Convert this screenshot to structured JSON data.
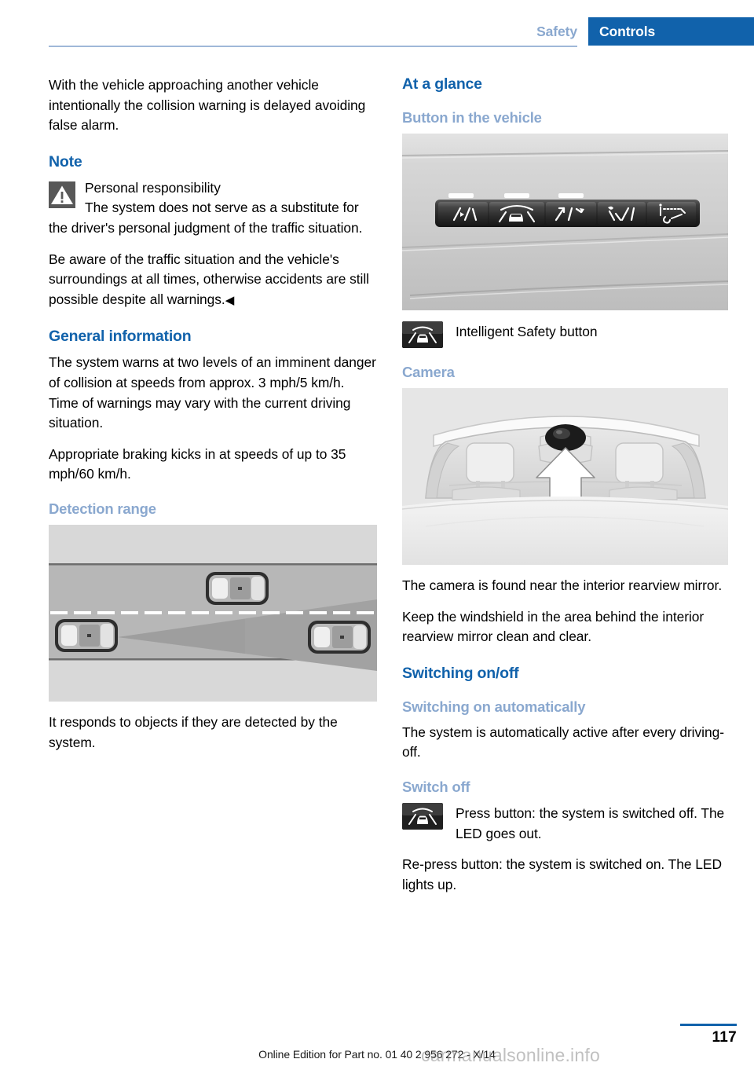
{
  "header": {
    "tab_inactive": "Safety",
    "tab_active": "Controls",
    "accent_color": "#1162ab",
    "inactive_color": "#8aa8cf"
  },
  "left_column": {
    "intro_paragraph": "With the vehicle approaching another vehicle intentionally the collision warning is delayed avoiding false alarm.",
    "note_heading": "Note",
    "note_icon": "warning-triangle-icon",
    "note_title": "Personal responsibility",
    "note_paragraph_1": "The system does not serve as a substitute for the driver's personal judgment of the traffic situation.",
    "note_paragraph_2": "Be aware of the traffic situation and the vehicle's surroundings at all times, otherwise accidents are still possible despite all warnings.",
    "note_end_mark": "◀",
    "general_heading": "General information",
    "general_paragraph_1": "The system warns at two levels of an imminent danger of collision at speeds from approx. 3 mph/5 km/h. Time of warnings may vary with the current driving situation.",
    "general_paragraph_2": "Appropriate braking kicks in at speeds of up to 35 mph/60 km/h.",
    "detection_heading": "Detection range",
    "detection_figure_alt": "top-down-road-detection-cone-illustration",
    "detection_paragraph": "It responds to objects if they are detected by the system."
  },
  "right_column": {
    "at_a_glance_heading": "At a glance",
    "button_heading": "Button in the vehicle",
    "button_photo_alt": "dashboard-button-strip-photo",
    "intelligent_safety_icon": "intelligent-safety-button-icon",
    "intelligent_safety_label": "Intelligent Safety button",
    "camera_heading": "Camera",
    "camera_figure_alt": "windshield-camera-location-illustration",
    "camera_paragraph_1": "The camera is found near the interior rearview mirror.",
    "camera_paragraph_2": "Keep the windshield in the area behind the interior rearview mirror clean and clear.",
    "switching_heading": "Switching on/off",
    "switching_on_heading": "Switching on automatically",
    "switching_on_paragraph": "The system is automatically active after every driving-off.",
    "switch_off_heading": "Switch off",
    "switch_off_icon": "intelligent-safety-button-icon",
    "switch_off_paragraph_1": "Press button: the system is switched off. The LED goes out.",
    "switch_off_paragraph_2": "Re-press button: the system is switched on. The LED lights up."
  },
  "footer": {
    "edition": "Online Edition for Part no. 01 40 2 956 272 - X/14",
    "page_number": "117",
    "watermark": "carmanualsonline.info"
  }
}
